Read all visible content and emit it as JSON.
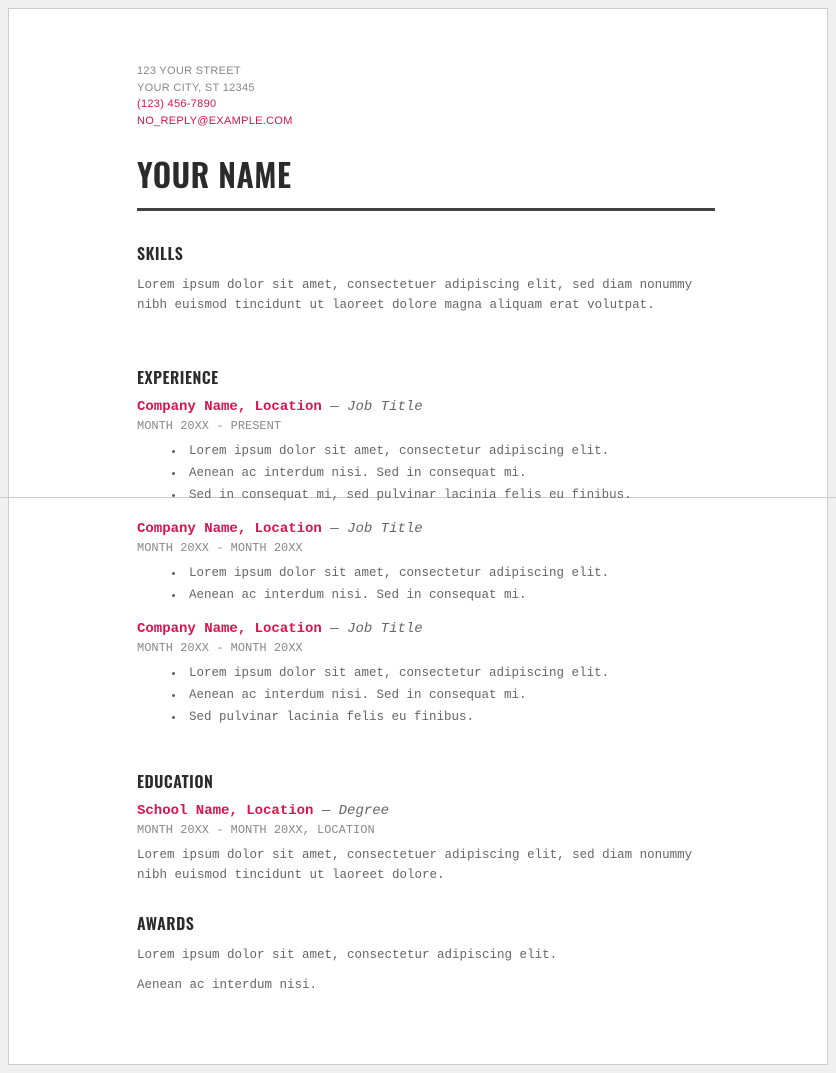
{
  "contact": {
    "street": "123 YOUR STREET",
    "city": "YOUR CITY, ST 12345",
    "phone": "(123) 456-7890",
    "email": "NO_REPLY@EXAMPLE.COM"
  },
  "name": "YOUR NAME",
  "sections": {
    "skills": {
      "heading": "SKILLS",
      "body": "Lorem ipsum dolor sit amet, consectetuer adipiscing elit, sed diam nonummy nibh euismod tincidunt ut laoreet dolore magna aliquam erat volutpat."
    },
    "experience": {
      "heading": "EXPERIENCE",
      "entries": [
        {
          "company": "Company Name, Location",
          "sep": "—",
          "title": "Job Title",
          "dates": "MONTH 20XX - PRESENT",
          "bullets": [
            "Lorem ipsum dolor sit amet, consectetur adipiscing elit.",
            "Aenean ac interdum nisi. Sed in consequat mi.",
            "Sed in consequat mi, sed pulvinar lacinia felis eu finibus."
          ]
        },
        {
          "company": "Company Name, Location",
          "sep": "—",
          "title": "Job Title",
          "dates": "MONTH 20XX - MONTH 20XX",
          "bullets": [
            "Lorem ipsum dolor sit amet, consectetur adipiscing elit.",
            "Aenean ac interdum nisi. Sed in consequat mi."
          ]
        },
        {
          "company": "Company Name, Location",
          "sep": "—",
          "title": "Job Title",
          "dates": "MONTH 20XX - MONTH 20XX",
          "bullets": [
            "Lorem ipsum dolor sit amet, consectetur adipiscing elit.",
            "Aenean ac interdum nisi. Sed in consequat mi.",
            "Sed pulvinar lacinia felis eu finibus."
          ]
        }
      ]
    },
    "education": {
      "heading": "EDUCATION",
      "school": "School Name, Location",
      "sep": "—",
      "degree": "Degree",
      "dates": "MONTH 20XX - MONTH 20XX, LOCATION",
      "body": "Lorem ipsum dolor sit amet, consectetuer adipiscing elit, sed diam nonummy nibh euismod tincidunt ut laoreet dolore."
    },
    "awards": {
      "heading": "AWARDS",
      "lines": [
        "Lorem ipsum dolor sit amet, consectetur adipiscing elit.",
        "Aenean ac interdum nisi."
      ]
    }
  }
}
